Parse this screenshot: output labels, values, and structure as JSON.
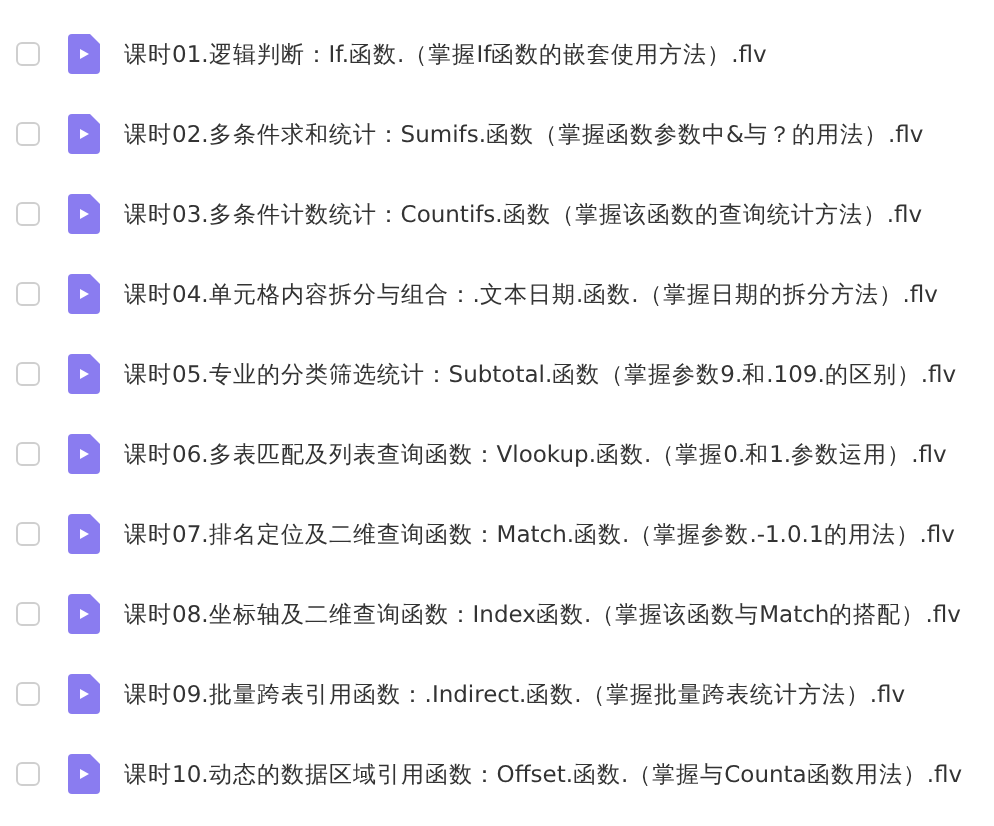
{
  "files": [
    {
      "name": "课时01.逻辑判断：If.函数.（掌握If函数的嵌套使用方法）.flv",
      "checked": false
    },
    {
      "name": "课时02.多条件求和统计：Sumifs.函数（掌握函数参数中&与？的用法）.flv",
      "checked": false
    },
    {
      "name": "课时03.多条件计数统计：Countifs.函数（掌握该函数的查询统计方法）.flv",
      "checked": false
    },
    {
      "name": "课时04.单元格内容拆分与组合：.文本日期.函数.（掌握日期的拆分方法）.flv",
      "checked": false
    },
    {
      "name": "课时05.专业的分类筛选统计：Subtotal.函数（掌握参数9.和.109.的区别）.flv",
      "checked": false
    },
    {
      "name": "课时06.多表匹配及列表查询函数：Vlookup.函数.（掌握0.和1.参数运用）.flv",
      "checked": false
    },
    {
      "name": "课时07.排名定位及二维查询函数：Match.函数.（掌握参数.-1.0.1的用法）.flv",
      "checked": false
    },
    {
      "name": "课时08.坐标轴及二维查询函数：Index函数.（掌握该函数与Match的搭配）.flv",
      "checked": false
    },
    {
      "name": "课时09.批量跨表引用函数：.Indirect.函数.（掌握批量跨表统计方法）.flv",
      "checked": false
    },
    {
      "name": "课时10.动态的数据区域引用函数：Offset.函数.（掌握与Counta函数用法）.flv",
      "checked": false
    }
  ]
}
